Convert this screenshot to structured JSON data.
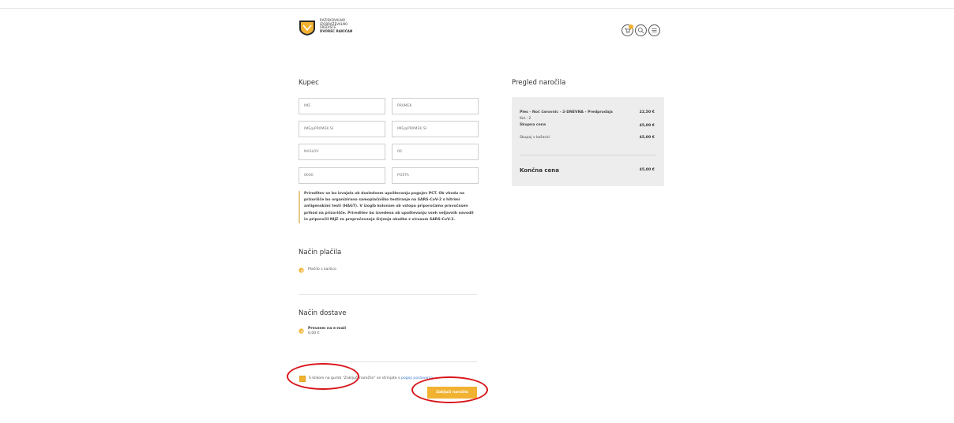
{
  "header": {
    "logo_lines": [
      "RAZISKOVALNO",
      "IZOBRAŽEVALNO",
      "SREDIŠČE",
      "DVOREC RAKIČAN"
    ]
  },
  "buyer": {
    "title": "Kupec",
    "fields": [
      {
        "placeholder": "IME"
      },
      {
        "placeholder": "PRIIMEK"
      },
      {
        "placeholder": "IME@PRIIMEK.SI"
      },
      {
        "placeholder": "IME@PRIIMEK.SI"
      },
      {
        "placeholder": "NASLOV"
      },
      {
        "placeholder": "00"
      },
      {
        "placeholder": "0000"
      },
      {
        "placeholder": "POŠTA"
      }
    ],
    "notice": "Prireditev se bo izvajala ob doslednem upoštevanju pogojev PCT. Ob vhodu na prizorišče bo organizirano samoplačniško testiranje na SARS-CoV-2 s hitrimi antigenskimi testi (HAGT). V izogib kolonam ob vstopu priporočamo pravočasen prihod na prizorišče. Prireditev bo izvedena ob upoštevanju vseh veljavnih navodil in priporočil NIJZ za preprečevanje širjenja okužbe z virusom SARS-CoV-2."
  },
  "payment": {
    "title": "Način plačila",
    "option": "Plačilo s kartico"
  },
  "delivery": {
    "title": "Način dostave",
    "option": "Prevzem na e-mail",
    "price": "0,00 €"
  },
  "terms": {
    "text": "S klikom na gumb \"Zaključi naročilo\" se strinjate s ",
    "link": "pogoji poslovanja"
  },
  "submit_label": "Zaključi naročilo",
  "summary": {
    "title": "Pregled naročila",
    "item_name": "Ples - Noč čarovnic - 2-DNEVNA - Predprodaja",
    "item_price": "22,50 €",
    "qty": "Kol.: 2",
    "subtotal_label": "Skupna cena",
    "subtotal_value": "45,00 €",
    "cart_label": "Skupaj v košarici",
    "cart_value": "45,00 €",
    "total_label": "Končna cena",
    "total_value": "45,00 €"
  },
  "colors": {
    "accent": "#f2b231",
    "annotation": "#d9151b",
    "link": "#3b76c9"
  }
}
